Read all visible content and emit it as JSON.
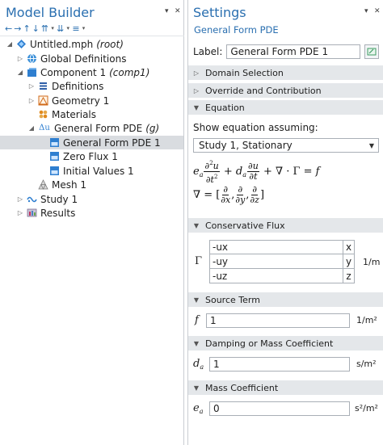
{
  "model_builder": {
    "title": "Model Builder",
    "tree": [
      {
        "label": "Untitled.mph",
        "suffix": "(root)",
        "icon": "mph-file-icon"
      },
      {
        "label": "Global Definitions",
        "icon": "globe-icon"
      },
      {
        "label": "Component 1",
        "suffix": "(comp1)",
        "icon": "component-icon"
      },
      {
        "label": "Definitions",
        "icon": "definitions-icon"
      },
      {
        "label": "Geometry 1",
        "icon": "geometry-icon"
      },
      {
        "label": "Materials",
        "icon": "materials-icon"
      },
      {
        "label": "General Form PDE",
        "suffix": "(g)",
        "icon": "pde-icon",
        "icon_text": "Δu"
      },
      {
        "label": "General Form PDE 1",
        "icon": "pde-node-icon"
      },
      {
        "label": "Zero Flux 1",
        "icon": "pde-node-icon"
      },
      {
        "label": "Initial Values 1",
        "icon": "pde-node-icon"
      },
      {
        "label": "Mesh 1",
        "icon": "mesh-icon"
      },
      {
        "label": "Study 1",
        "icon": "study-icon"
      },
      {
        "label": "Results",
        "icon": "results-icon"
      }
    ]
  },
  "settings": {
    "title": "Settings",
    "subtitle": "General Form PDE",
    "label_caption": "Label:",
    "label_value": "General Form PDE 1",
    "sections": {
      "domain_selection": "Domain Selection",
      "override": "Override and Contribution",
      "equation": "Equation",
      "conservative_flux": "Conservative Flux",
      "source_term": "Source Term",
      "damping": "Damping or Mass Coefficient",
      "mass": "Mass Coefficient"
    },
    "show_equation_label": "Show equation assuming:",
    "study_option": "Study 1, Stationary",
    "flux": {
      "symbol": "Γ",
      "unit": "1/m",
      "rows": [
        {
          "value": "-ux",
          "component": "x"
        },
        {
          "value": "-uy",
          "component": "y"
        },
        {
          "value": "-uz",
          "component": "z"
        }
      ]
    },
    "source": {
      "symbol": "f",
      "value": "1",
      "unit": "1/m²"
    },
    "damping": {
      "symbol": "d",
      "sub": "a",
      "value": "1",
      "unit": "s/m²"
    },
    "mass": {
      "symbol": "e",
      "sub": "a",
      "value": "0",
      "unit": "s²/m²"
    }
  }
}
